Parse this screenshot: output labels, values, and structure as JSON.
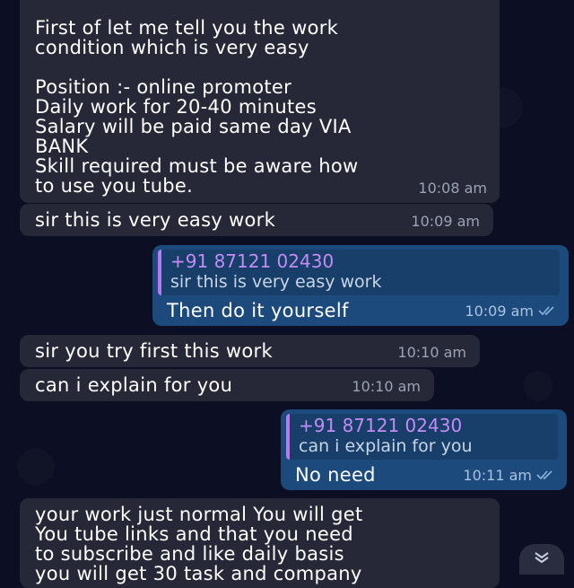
{
  "messages": [
    {
      "id": "m1",
      "direction": "incoming",
      "text": "First of let me tell you the work\ncondition which is very easy\n\nPosition :- online promoter\nDaily work for 20-40 minutes\nSalary will be paid same day VIA\nBANK\nSkill required must be aware how\nto use you tube.",
      "time": "10:08 am"
    },
    {
      "id": "m2",
      "direction": "incoming",
      "text": "sir this is very easy work",
      "time": "10:09 am"
    },
    {
      "id": "m3",
      "direction": "outgoing",
      "reply_to": {
        "sender": "+91 87121 02430",
        "text": "sir this is very easy work"
      },
      "text": "Then do it yourself",
      "time": "10:09 am",
      "status_icon": "double-check-icon"
    },
    {
      "id": "m4",
      "direction": "incoming",
      "text": "sir you try first this work",
      "time": "10:10 am"
    },
    {
      "id": "m5",
      "direction": "incoming",
      "text": "can i explain for you",
      "time": "10:10 am"
    },
    {
      "id": "m6",
      "direction": "outgoing",
      "reply_to": {
        "sender": "+91 87121 02430",
        "text": "can i explain for you"
      },
      "text": "No need",
      "time": "10:11 am",
      "status_icon": "double-check-icon"
    },
    {
      "id": "m7",
      "direction": "incoming",
      "text": "your work just normal You will get\nYou tube links and that you need\nto subscribe and like daily basis\nyou will get 30 task and company"
    }
  ],
  "scroll_button": {
    "icon": "double-chevron-down-icon"
  },
  "colors": {
    "background": "#0c0f23",
    "incoming_bubble": "#262837",
    "outgoing_bubble": "#1c4a7c",
    "reply_accent": "#c58bf5"
  }
}
